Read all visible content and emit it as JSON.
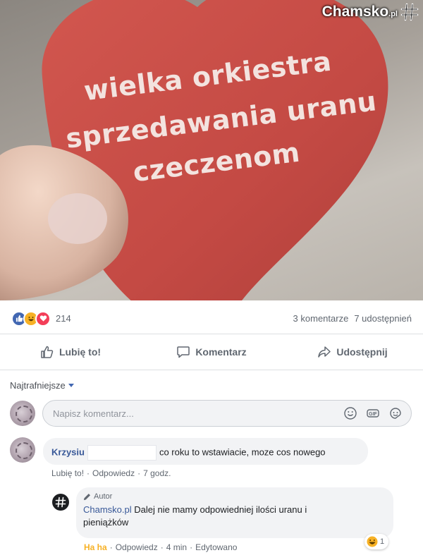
{
  "watermark": {
    "brand": "Chamsko",
    "suffix": ".pl"
  },
  "image_text": {
    "line1": "wielka orkiestra",
    "line2": "sprzedawania uranu",
    "line3": "czeczenom"
  },
  "stats": {
    "reaction_count": "214",
    "comments": "3 komentarze",
    "shares": "7 udostępnień",
    "reactions": [
      "like",
      "haha",
      "love"
    ]
  },
  "actions": {
    "like": "Lubię to!",
    "comment": "Komentarz",
    "share": "Udostępnij"
  },
  "sort": {
    "label": "Najtrafniejsze"
  },
  "compose": {
    "placeholder": "Napisz komentarz..."
  },
  "comments": [
    {
      "author": "Krzysiu",
      "text": "co roku to wstawiacie, moze cos nowego",
      "like": "Lubię to!",
      "reply": "Odpowiedz",
      "time": "7 godz."
    }
  ],
  "reply": {
    "author_badge": "Autor",
    "author": "Chamsko.pl",
    "text_line1": "Dalej nie mamy odpowiedniej ilości uranu i",
    "text_line2": "pieniążków",
    "reaction_label": "Ha ha",
    "reply": "Odpowiedz",
    "time": "4 min",
    "edited": "Edytowano",
    "reaction_count": "1"
  },
  "colors": {
    "facebook_blue": "#4267b2",
    "link_blue": "#385898",
    "haha_orange": "#f7b125",
    "heart_red": "#c94c47"
  }
}
